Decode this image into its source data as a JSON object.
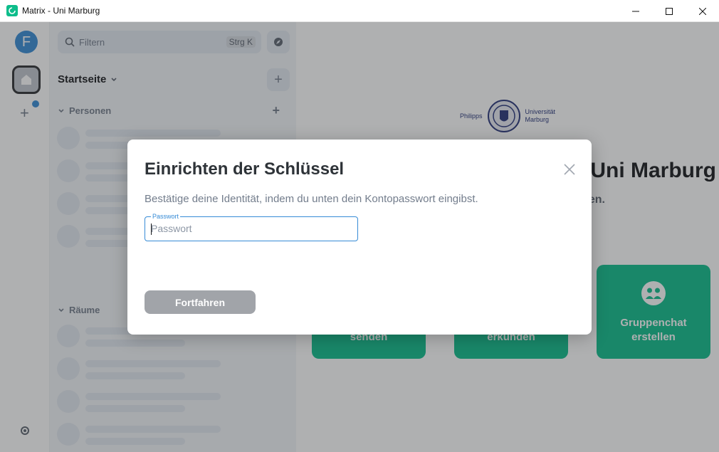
{
  "window": {
    "title": "Matrix - Uni Marburg",
    "controls": [
      "minimize-icon",
      "maximize-icon",
      "close-icon"
    ]
  },
  "spaces": {
    "avatar_letter": "F",
    "avatar_color": "#368bd6",
    "notification_color": "#368bd6"
  },
  "roomlist": {
    "search_placeholder": "Filtern",
    "search_shortcut": "Strg K",
    "home_title": "Startseite",
    "sections": {
      "people": "Personen",
      "rooms": "Räume"
    }
  },
  "main": {
    "logo_text_left": "Philipps",
    "logo_text_right_1": "Universität",
    "logo_text_right_2": "Marburg",
    "welcome_title_visible": "Uni Marburg",
    "welcome_sub_visible": "en.",
    "actions": [
      {
        "label_visible": "senden"
      },
      {
        "label_visible": "erkunden"
      },
      {
        "label_line1": "Gruppenchat",
        "label_line2": "erstellen"
      }
    ],
    "accent_color": "#0dbd8b"
  },
  "dialog": {
    "title": "Einrichten der Schlüssel",
    "description": "Bestätige deine Identität, indem du unten dein Kontopasswort eingibst.",
    "password_label": "Passwort",
    "password_placeholder": "Passwort",
    "password_value": "",
    "continue_label": "Fortfahren",
    "continue_disabled_color": "#a1a4a9",
    "focus_color": "#368bd6"
  }
}
